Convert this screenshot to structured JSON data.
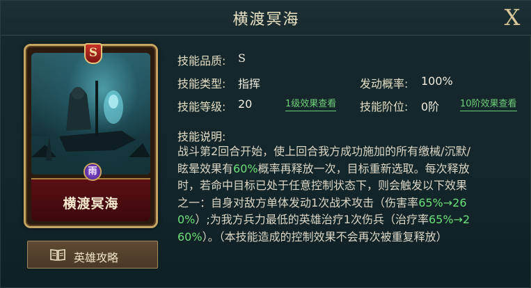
{
  "header": {
    "title": "横渡冥海",
    "close_label": "X"
  },
  "card": {
    "grade": "S",
    "name": "横渡冥海",
    "emblem": "雨"
  },
  "guide_button": {
    "label": "英雄攻略",
    "icon": "book-icon"
  },
  "info": {
    "quality_label": "技能品质:",
    "quality_value": "S",
    "type_label": "技能类型:",
    "type_value": "指挥",
    "probability_label": "发动概率:",
    "probability_value": "100%",
    "level_label": "技能等级:",
    "level_value": "20",
    "level_link": "1级效果查看",
    "tier_label": "技能阶位:",
    "tier_value": "0阶",
    "tier_link": "10阶效果查看"
  },
  "description": {
    "title": "技能说明:",
    "lines": [
      [
        {
          "t": "战斗第2回合开始，使上回合我方成功施加的所有缴械/沉默/"
        }
      ],
      [
        {
          "t": "眩晕效果有"
        },
        {
          "t": "60%",
          "hl": true
        },
        {
          "t": "概率再释放一次，目标重新选取。每次释放"
        }
      ],
      [
        {
          "t": "时，若命中目标已处于任意控制状态下，则会触发以下效果"
        }
      ],
      [
        {
          "t": "之一：自身对敌方单体发动1次战术攻击（伤害率"
        },
        {
          "t": "65%→26",
          "hl": true
        }
      ],
      [
        {
          "t": "0%",
          "hl": true
        },
        {
          "t": "）;为我方兵力最低的英雄治疗1次伤兵（治疗率"
        },
        {
          "t": "65%→2",
          "hl": true
        }
      ],
      [
        {
          "t": "60%",
          "hl": true
        },
        {
          "t": "）。（本技能造成的控制效果不会再次被重复释放）"
        }
      ]
    ]
  },
  "colors": {
    "highlight": "#6ce07a",
    "gold": "#c4a562",
    "plate": "#5a0f14"
  }
}
